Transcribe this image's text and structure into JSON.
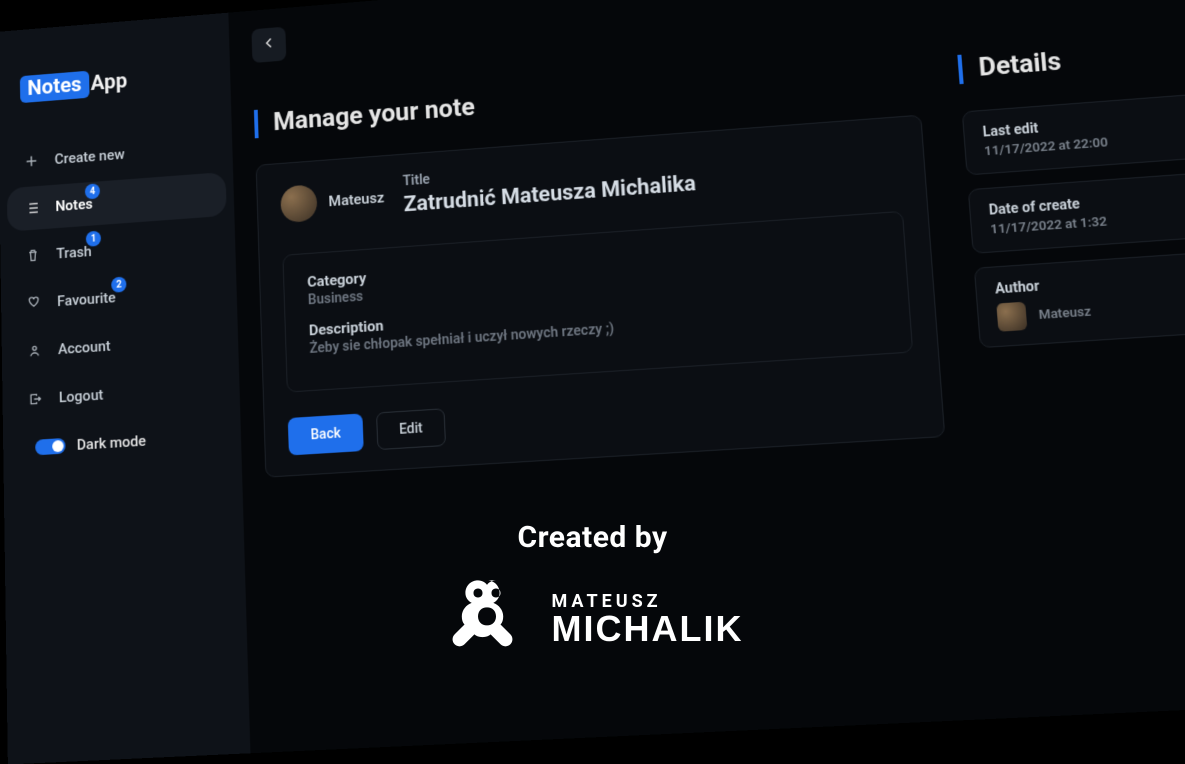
{
  "logo": {
    "badge": "Notes",
    "text": "App"
  },
  "sidebar": {
    "items": [
      {
        "label": "Create new",
        "icon": "plus-icon"
      },
      {
        "label": "Notes",
        "icon": "list-icon",
        "badge": "4",
        "active": true
      },
      {
        "label": "Trash",
        "icon": "trash-icon",
        "badge": "1"
      },
      {
        "label": "Favourite",
        "icon": "heart-icon",
        "badge": "2"
      },
      {
        "label": "Account",
        "icon": "user-icon"
      },
      {
        "label": "Logout",
        "icon": "logout-icon"
      }
    ],
    "darkmode_label": "Dark mode",
    "darkmode_on": true
  },
  "page": {
    "heading": "Manage your note",
    "details_heading": "Details"
  },
  "note": {
    "author": "Mateusz",
    "title_label": "Title",
    "title": "Zatrudnić Mateusza Michalika",
    "category_label": "Category",
    "category": "Business",
    "description_label": "Description",
    "description": "Żeby sie chłopak spełniał i uczył nowych rzeczy ;)",
    "back_label": "Back",
    "edit_label": "Edit"
  },
  "details": {
    "last_edit_label": "Last edit",
    "last_edit_value": "11/17/2022 at 22:00",
    "created_label": "Date of create",
    "created_value": "11/17/2022 at 1:32",
    "author_label": "Author",
    "author_name": "Mateusz"
  },
  "overlay": {
    "created_by": "Created by",
    "first": "MATEUSZ",
    "last": "MICHALIK"
  }
}
